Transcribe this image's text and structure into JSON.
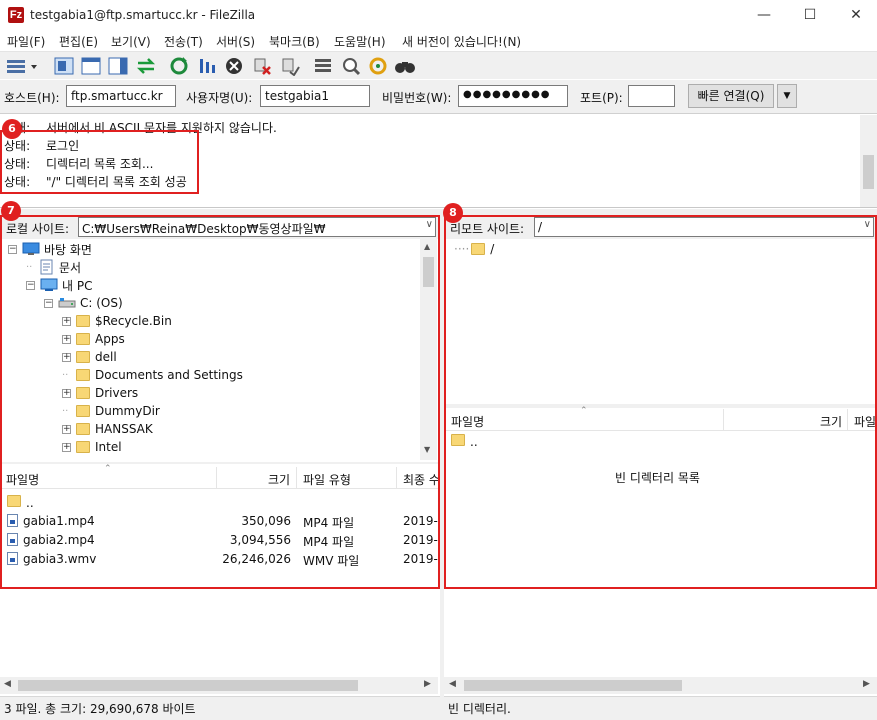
{
  "window": {
    "title": "testgabia1@ftp.smartucc.kr - FileZilla",
    "app_icon": "Fz"
  },
  "menu": [
    "파일(F)",
    "편집(E)",
    "보기(V)",
    "전송(T)",
    "서버(S)",
    "북마크(B)",
    "도움말(H)",
    "새 버전이 있습니다!(N)"
  ],
  "quickconnect": {
    "host_label": "호스트(H):",
    "host_value": "ftp.smartucc.kr",
    "user_label": "사용자명(U):",
    "user_value": "testgabia1",
    "pass_label": "비밀번호(W):",
    "pass_value": "●●●●●●●●●",
    "port_label": "포트(P):",
    "port_value": "",
    "connect_label": "빠른 연결(Q)"
  },
  "log": {
    "lines": [
      {
        "label": "상태:",
        "text": "서버에서 비 ASCII 문자를 지원하지 않습니다."
      },
      {
        "label": "상태:",
        "text": "로그인"
      },
      {
        "label": "상태:",
        "text": "디렉터리 목록 조회..."
      },
      {
        "label": "상태:",
        "text": "\"/\" 디렉터리 목록 조회 성공"
      }
    ]
  },
  "badges": {
    "log": "6",
    "local": "7",
    "remote": "8"
  },
  "local": {
    "site_label": "로컬 사이트:",
    "path": "C:₩Users₩Reina₩Desktop₩동영상파일₩",
    "tree": [
      {
        "label": "바탕 화면",
        "indent": 0,
        "exp": "⊟",
        "icon": "desktop"
      },
      {
        "label": "문서",
        "indent": 1,
        "exp": "",
        "icon": "doc"
      },
      {
        "label": "내 PC",
        "indent": 1,
        "exp": "⊟",
        "icon": "pc"
      },
      {
        "label": "C: (OS)",
        "indent": 2,
        "exp": "⊟",
        "icon": "drive"
      },
      {
        "label": "$Recycle.Bin",
        "indent": 3,
        "exp": "⊞",
        "icon": "folder"
      },
      {
        "label": "Apps",
        "indent": 3,
        "exp": "⊞",
        "icon": "folder"
      },
      {
        "label": "dell",
        "indent": 3,
        "exp": "⊞",
        "icon": "folder"
      },
      {
        "label": "Documents and Settings",
        "indent": 3,
        "exp": "",
        "icon": "folder"
      },
      {
        "label": "Drivers",
        "indent": 3,
        "exp": "⊞",
        "icon": "folder"
      },
      {
        "label": "DummyDir",
        "indent": 3,
        "exp": "",
        "icon": "folder"
      },
      {
        "label": "HANSSAK",
        "indent": 3,
        "exp": "⊞",
        "icon": "folder"
      },
      {
        "label": "Intel",
        "indent": 3,
        "exp": "⊞",
        "icon": "folder"
      }
    ],
    "columns": {
      "name": "파일명",
      "size": "크기",
      "type": "파일 유형",
      "modified": "최종 수"
    },
    "files": [
      {
        "name": "..",
        "size": "",
        "type": "",
        "modified": "",
        "kind": "folder"
      },
      {
        "name": "gabia1.mp4",
        "size": "350,096",
        "type": "MP4 파일",
        "modified": "2019-",
        "kind": "file"
      },
      {
        "name": "gabia2.mp4",
        "size": "3,094,556",
        "type": "MP4 파일",
        "modified": "2019-",
        "kind": "file"
      },
      {
        "name": "gabia3.wmv",
        "size": "26,246,026",
        "type": "WMV 파일",
        "modified": "2019-",
        "kind": "file"
      }
    ],
    "status": "3 파일. 총 크기: 29,690,678 바이트"
  },
  "remote": {
    "site_label": "리모트 사이트:",
    "path": "/",
    "tree": [
      {
        "label": "/"
      }
    ],
    "columns": {
      "name": "파일명",
      "size": "크기",
      "perm": "파일"
    },
    "files": [
      {
        "name": ".."
      }
    ],
    "empty_text": "빈 디렉터리 목록",
    "status": "빈 디렉터리."
  },
  "colors": {
    "accent_red": "#e02020",
    "folder": "#f8d775"
  }
}
